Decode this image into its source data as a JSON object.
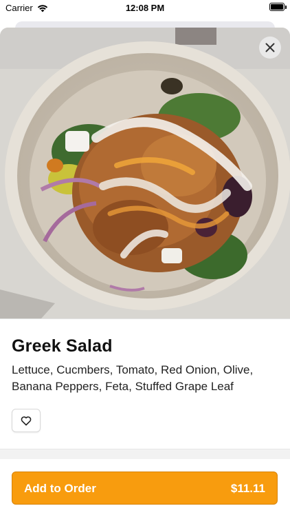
{
  "status_bar": {
    "carrier": "Carrier",
    "time": "12:08 PM"
  },
  "item": {
    "name": "Greek Salad",
    "description": "Lettuce, Cucmbers, Tomato, Red Onion, Olive, Banana Peppers, Feta, Stuffed Grape Leaf",
    "image_alt": "salad bowl photo"
  },
  "actions": {
    "close_icon": "close-icon",
    "favorite_icon": "heart-outline-icon"
  },
  "footer": {
    "add_label": "Add to Order",
    "price": "$11.11"
  },
  "colors": {
    "accent": "#f89c0e"
  }
}
